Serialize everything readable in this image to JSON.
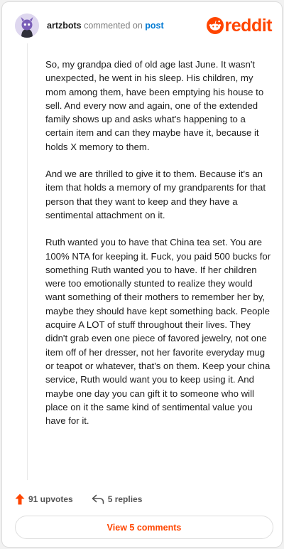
{
  "header": {
    "username": "artzbots",
    "action_text": "commented on",
    "post_link": "post",
    "logo_text": "reddit"
  },
  "comment": {
    "paragraphs": [
      "So, my grandpa died of old age last June. It wasn't unexpected, he went in his sleep. His children, my mom among them, have been emptying his house to sell. And every now and again, one of the extended family shows up and asks what's happening to a certain item and can they maybe have it, because it holds X memory to them.",
      "And we are thrilled to give it to them. Because it's an item that holds a memory of my grandparents for that person that they want to keep and they have a sentimental attachment on it.",
      "Ruth wanted you to have that China tea set. You are 100% NTA for keeping it. Fuck, you paid 500 bucks for something Ruth wanted you to have. If her children were too emotionally stunted to realize they would want something of their mothers to remember her by, maybe they should have kept something back. People acquire A LOT of stuff throughout their lives. They didn't grab even one piece of favored jewelry, not one item off of her dresser, not her favorite everyday mug or teapot or whatever, that's on them. Keep your china service, Ruth would want you to keep using it. And maybe one day you can gift it to someone who will place on it the same kind of sentimental value you have for it."
    ]
  },
  "footer": {
    "upvotes": "91 upvotes",
    "replies": "5 replies",
    "view_button": "View 5 comments"
  },
  "colors": {
    "brand": "#ff4500",
    "link": "#0079d3"
  },
  "icons": {
    "avatar": "snoo-avatar-icon",
    "logo": "reddit-snoo-icon",
    "upvote": "upvote-arrow-icon",
    "reply": "reply-arrow-icon"
  }
}
